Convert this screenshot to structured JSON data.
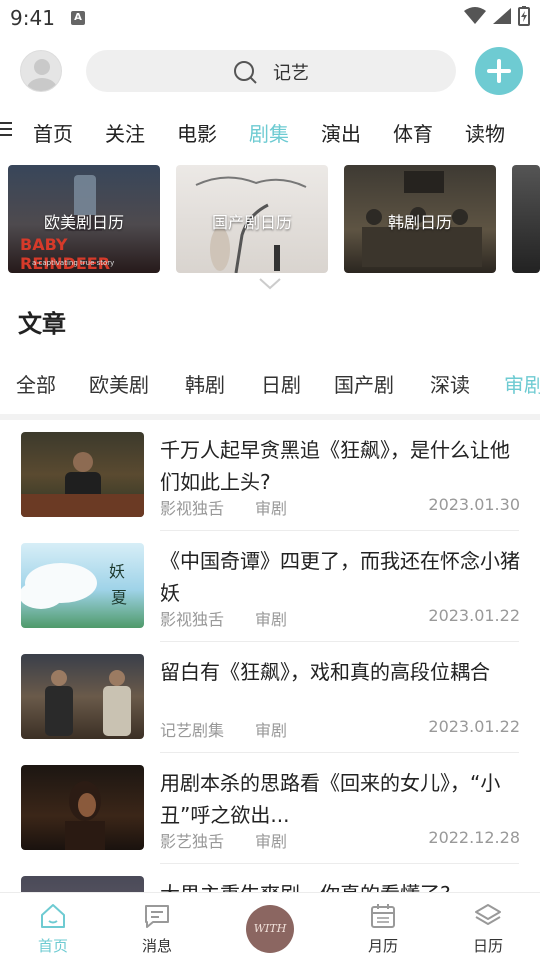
{
  "status_bar": {
    "time": "9:41",
    "badge": "A"
  },
  "header": {
    "search_text": "记艺"
  },
  "category_nav": {
    "items": [
      "首页",
      "关注",
      "电影",
      "剧集",
      "演出",
      "体育",
      "读物"
    ],
    "active": "剧集"
  },
  "calendar_cards": [
    {
      "label": "欧美剧日历",
      "poster_text": "BABY REINDEER",
      "poster_sub": "a captivating true story"
    },
    {
      "label": "国产剧日历"
    },
    {
      "label": "韩剧日历"
    }
  ],
  "articles_section": {
    "title": "文章",
    "filters": [
      "全部",
      "欧美剧",
      "韩剧",
      "日剧",
      "国产剧",
      "深读",
      "审剧"
    ],
    "active_filter": "审剧"
  },
  "articles": [
    {
      "title": "千万人起早贪黑追《狂飙》，是什么让他们如此上头?",
      "source": "影视独舌",
      "category": "审剧",
      "date": "2023.01.30"
    },
    {
      "title": "《中国奇谭》四更了，而我还在怀念小猪妖",
      "source": "影视独舌",
      "category": "审剧",
      "date": "2023.01.22"
    },
    {
      "title": "留白有《狂飙》，戏和真的高段位耦合",
      "source": "记艺剧集",
      "category": "审剧",
      "date": "2023.01.22"
    },
    {
      "title": "用剧本杀的思路看《回来的女儿》，“小丑”呼之欲出...",
      "source": "影艺独舌",
      "category": "审剧",
      "date": "2022.12.28"
    },
    {
      "title": "大男主重生爽剧，你真的看懂了?",
      "source": "",
      "category": "",
      "date": ""
    }
  ],
  "tabbar": {
    "items": [
      "首页",
      "消息",
      "月历",
      "日历"
    ],
    "center_label": "WITH",
    "active": "首页"
  },
  "colors": {
    "accent": "#6ecbd2",
    "center_button": "#8b6661"
  }
}
